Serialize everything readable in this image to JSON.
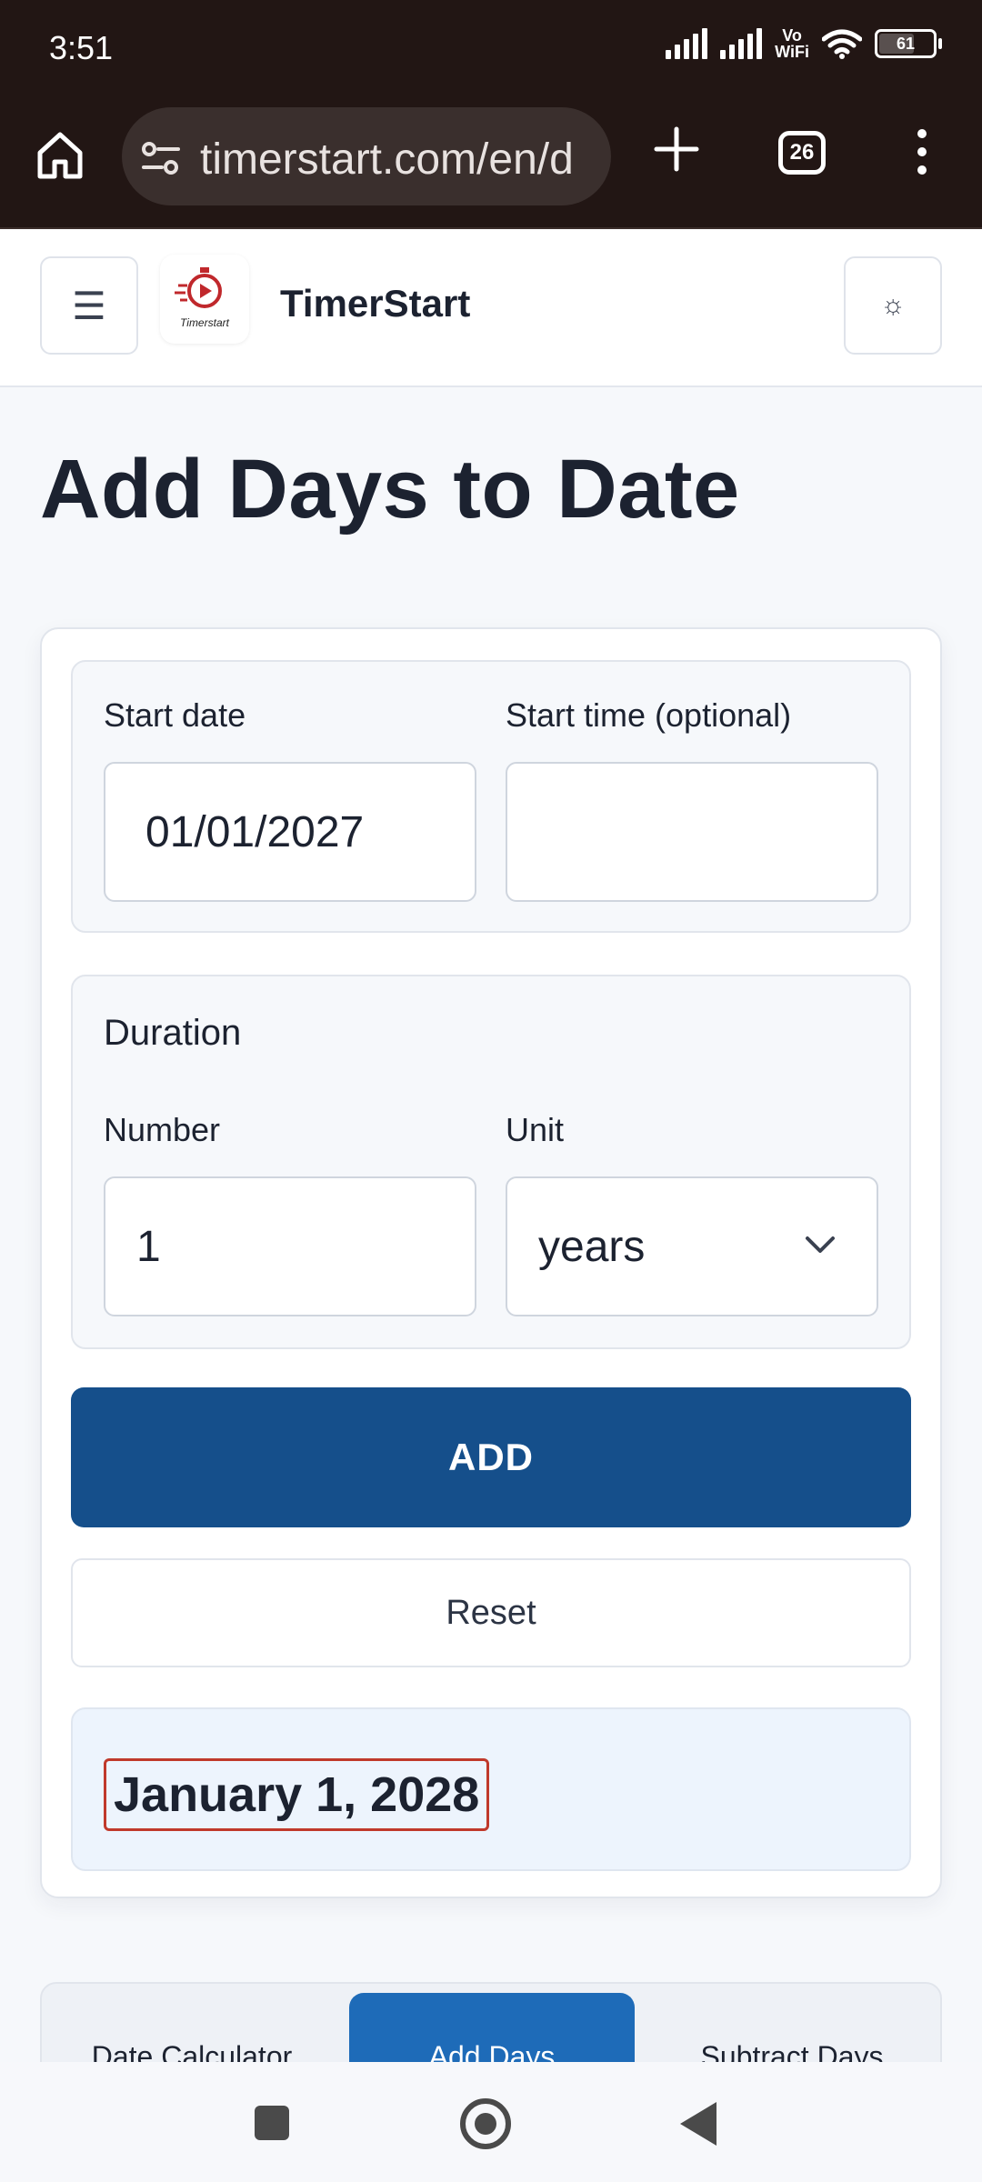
{
  "status_bar": {
    "time": "3:51",
    "network_label": "Vo\nWiFi",
    "battery_level": "61"
  },
  "browser": {
    "url": "timerstart.com/en/d",
    "tab_count": "26",
    "icons": [
      "home-icon",
      "site-settings-icon",
      "new-tab-icon",
      "tab-switcher-icon",
      "overflow-menu-icon"
    ]
  },
  "header": {
    "menu_glyph": "☰",
    "logo_text": "Timerstart",
    "brand": "TimerStart",
    "theme_glyph": "☼"
  },
  "page": {
    "title": "Add Days to Date"
  },
  "form": {
    "start_date_label": "Start date",
    "start_date_value": "01/01/2027",
    "start_time_label": "Start time (optional)",
    "start_time_value": "",
    "duration_heading": "Duration",
    "number_label": "Number",
    "number_value": "1",
    "unit_label": "Unit",
    "unit_value": "years",
    "add_label": "ADD",
    "reset_label": "Reset"
  },
  "result": {
    "text": "January 1, 2028",
    "highlight_color": "#c0392b"
  },
  "tabs": [
    {
      "label": "Date Calculator",
      "active": false
    },
    {
      "label": "Add Days",
      "active": true
    },
    {
      "label": "Subtract Days",
      "active": false
    }
  ],
  "colors": {
    "primary_button": "#154f8b",
    "active_tab": "#1e6bb8",
    "browser_chrome": "#221614"
  }
}
